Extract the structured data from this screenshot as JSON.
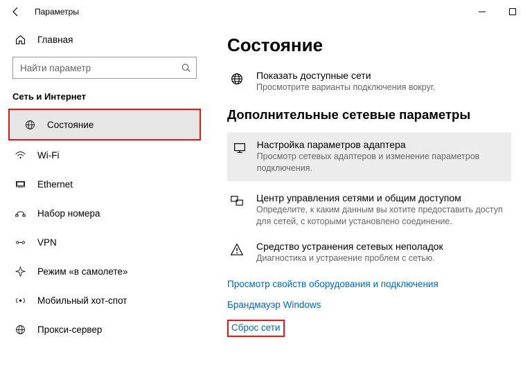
{
  "titlebar": {
    "app_title": "Параметры"
  },
  "sidebar": {
    "home_label": "Главная",
    "search_placeholder": "Найти параметр",
    "section_title": "Сеть и Интернет",
    "items": [
      {
        "label": "Состояние"
      },
      {
        "label": "Wi-Fi"
      },
      {
        "label": "Ethernet"
      },
      {
        "label": "Набор номера"
      },
      {
        "label": "VPN"
      },
      {
        "label": "Режим «в самолете»"
      },
      {
        "label": "Мобильный хот-спот"
      },
      {
        "label": "Прокси-сервер"
      }
    ]
  },
  "main": {
    "page_title": "Состояние",
    "show_networks": {
      "title": "Показать доступные сети",
      "desc": "Просмотрите варианты подключения вокруг."
    },
    "advanced_title": "Дополнительные сетевые параметры",
    "adapter": {
      "title": "Настройка параметров адаптера",
      "desc": "Просмотр сетевых адаптеров и изменение параметров подключения."
    },
    "sharing": {
      "title": "Центр управления сетями и общим доступом",
      "desc": "Определите, к каким данным вы хотите предоставить доступ для сетей, с которыми установлено соединение."
    },
    "troubleshoot": {
      "title": "Средство устранения сетевых неполадок",
      "desc": "Диагностика и устранение проблем с сетью."
    },
    "link_props": "Просмотр свойств оборудования и подключения",
    "link_firewall": "Брандмауэр Windows",
    "link_reset": "Сброс сети"
  }
}
